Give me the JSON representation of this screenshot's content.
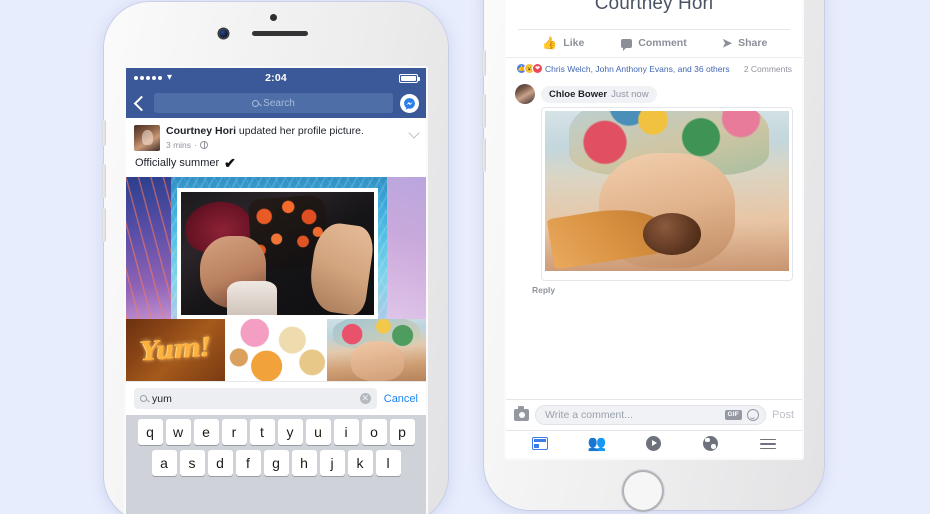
{
  "background_color": "#e8edfd",
  "left_phone": {
    "status_bar": {
      "signal_dots": 5,
      "wifi_icon": "wifi-icon",
      "time": "2:04",
      "battery_icon": "battery-full-icon"
    },
    "nav_bar": {
      "back_icon": "back-chevron-icon",
      "search_placeholder": "Search",
      "search_icon": "search-icon",
      "messenger_icon": "messenger-icon"
    },
    "post": {
      "author": "Courtney Hori",
      "action": " updated her profile picture.",
      "timestamp": "3 mins",
      "privacy_icon": "globe-icon",
      "separator": "·",
      "menu_icon": "chevron-down-icon",
      "body_text": "Officially summer",
      "body_glyph": "✔",
      "avatar": "author-avatar"
    },
    "collage_image": "profile-collage-photo",
    "gif_results": [
      {
        "name": "gif-result-yum",
        "label": "Yum!"
      },
      {
        "name": "gif-result-donuts",
        "label": ""
      },
      {
        "name": "gif-result-kid-icecream",
        "label": ""
      }
    ],
    "gif_search": {
      "value": "yum",
      "search_icon": "search-icon",
      "clear_icon": "clear-icon",
      "clear_glyph": "✕",
      "cancel_label": "Cancel",
      "cancel_color": "#1b84f0"
    },
    "keyboard": {
      "row1": [
        "q",
        "w",
        "e",
        "r",
        "t",
        "y",
        "u",
        "i",
        "o",
        "p"
      ],
      "row2": [
        "a",
        "s",
        "d",
        "f",
        "g",
        "h",
        "j",
        "k",
        "l"
      ]
    }
  },
  "right_phone": {
    "cover_photo": "profile-cover-photo",
    "profile_name": "Courtney Hori",
    "actions": [
      {
        "name": "like-button",
        "label": "Like",
        "icon": "thumbs-up-icon",
        "glyph": "👍"
      },
      {
        "name": "comment-button",
        "label": "Comment",
        "icon": "comment-icon",
        "glyph": ""
      },
      {
        "name": "share-button",
        "label": "Share",
        "icon": "share-arrow-icon",
        "glyph": "➤"
      }
    ],
    "reactions": {
      "icons": [
        "like-reaction",
        "wow-reaction",
        "love-reaction"
      ],
      "text": "Chris Welch, John Anthony Evans, and 36 others",
      "comment_count": "2 Comments",
      "text_color": "#4267b2"
    },
    "comment": {
      "avatar": "commenter-avatar",
      "author": "Chloe Bower",
      "time": "Just now",
      "gif_image": "gif-kid-eating-icecream",
      "reply_label": "Reply"
    },
    "composer": {
      "camera_icon": "camera-icon",
      "placeholder": "Write a comment...",
      "gif_label": "GIF",
      "emoji_icon": "emoji-icon",
      "post_label": "Post"
    },
    "tab_bar": [
      {
        "name": "tab-news-feed",
        "icon": "news-feed-icon",
        "active": true
      },
      {
        "name": "tab-friends",
        "icon": "friends-icon",
        "glyph": "👥",
        "active": false
      },
      {
        "name": "tab-video",
        "icon": "video-play-icon",
        "active": false
      },
      {
        "name": "tab-notifications",
        "icon": "globe-icon",
        "active": false
      },
      {
        "name": "tab-menu",
        "icon": "hamburger-menu-icon",
        "active": false
      }
    ]
  }
}
